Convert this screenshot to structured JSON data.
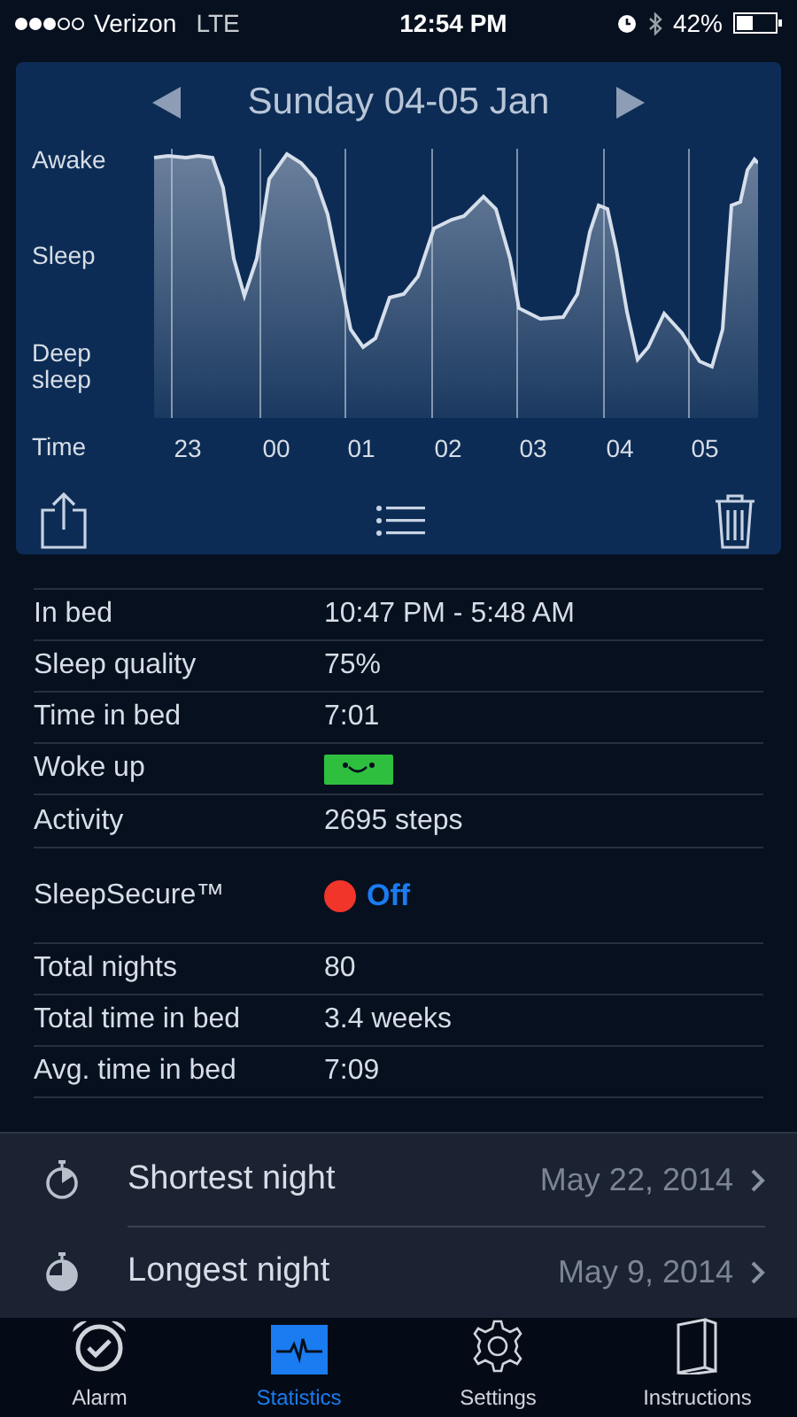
{
  "status_bar": {
    "carrier": "Verizon",
    "network": "LTE",
    "time": "12:54 PM",
    "battery": "42%"
  },
  "sleep_card": {
    "title": "Sunday 04-05 Jan",
    "y_labels": [
      "Awake",
      "Sleep",
      "Deep sleep"
    ],
    "x_axis_label": "Time",
    "x_labels": [
      "23",
      "00",
      "01",
      "02",
      "03",
      "04",
      "05"
    ]
  },
  "details": [
    {
      "label": "In bed",
      "value": "10:47 PM - 5:48 AM",
      "kind": "text"
    },
    {
      "label": "Sleep quality",
      "value": "75%",
      "kind": "text"
    },
    {
      "label": "Time in bed",
      "value": "7:01",
      "kind": "text"
    },
    {
      "label": "Woke up",
      "kind": "mood",
      "color": "#2fbf3f"
    },
    {
      "label": "Activity",
      "value": "2695 steps",
      "kind": "text"
    }
  ],
  "sleep_secure": {
    "label": "SleepSecure™",
    "value": "Off",
    "on": false
  },
  "totals": [
    {
      "label": "Total nights",
      "value": "80"
    },
    {
      "label": "Total time in bed",
      "value": "3.4 weeks"
    },
    {
      "label": "Avg. time in bed",
      "value": "7:09"
    }
  ],
  "records": [
    {
      "label": "Shortest night",
      "date": "May 22, 2014",
      "kind": "short"
    },
    {
      "label": "Longest night",
      "date": "May 9, 2014",
      "kind": "long"
    }
  ],
  "tabs": [
    {
      "label": "Alarm",
      "selected": false,
      "kind": "alarm"
    },
    {
      "label": "Statistics",
      "selected": true,
      "kind": "stats"
    },
    {
      "label": "Settings",
      "selected": false,
      "kind": "settings"
    },
    {
      "label": "Instructions",
      "selected": false,
      "kind": "book"
    }
  ]
}
